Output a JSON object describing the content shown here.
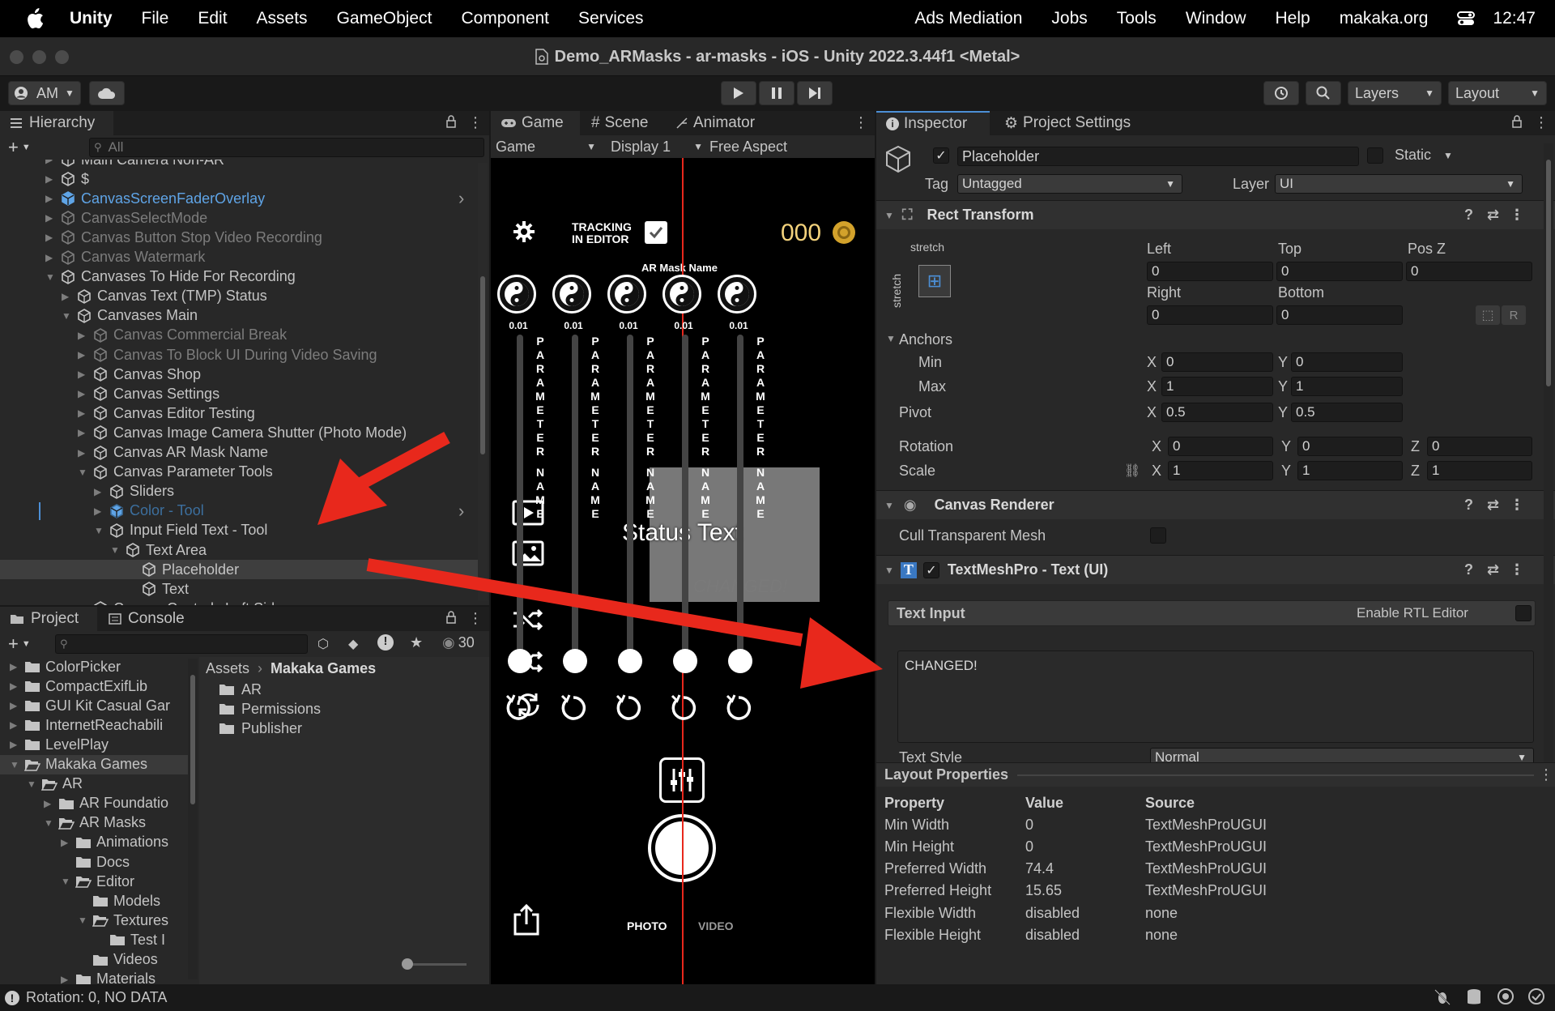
{
  "menu": {
    "unity": "Unity",
    "items": [
      "File",
      "Edit",
      "Assets",
      "GameObject",
      "Component",
      "Services"
    ],
    "right_items": [
      "Ads Mediation",
      "Jobs",
      "Tools",
      "Window",
      "Help",
      "makaka.org"
    ],
    "clock": "12:47"
  },
  "window": {
    "title": "Demo_ARMasks - ar-masks - iOS - Unity 2022.3.44f1 <Metal>"
  },
  "toolbar": {
    "account": "AM",
    "layers": "Layers",
    "layout": "Layout"
  },
  "hierarchy": {
    "tab": "Hierarchy",
    "search_placeholder": "All",
    "rows": [
      {
        "label": "Main Camera Non-AR",
        "indent": 0,
        "dim": false,
        "blue": false
      },
      {
        "label": "$",
        "indent": 0,
        "dim": false,
        "blue": false
      },
      {
        "label": "CanvasScreenFaderOverlay",
        "indent": 0,
        "dim": false,
        "blue": true
      },
      {
        "label": "CanvasSelectMode",
        "indent": 0,
        "dim": true,
        "blue": false
      },
      {
        "label": "Canvas Button Stop Video Recording",
        "indent": 0,
        "dim": true,
        "blue": false
      },
      {
        "label": "Canvas Watermark",
        "indent": 0,
        "dim": true,
        "blue": false
      },
      {
        "label": "Canvases To Hide For Recording",
        "indent": 0,
        "dim": false,
        "blue": false
      },
      {
        "label": "Canvas Text (TMP) Status",
        "indent": 1,
        "dim": false,
        "blue": false
      },
      {
        "label": "Canvases Main",
        "indent": 1,
        "dim": false,
        "blue": false
      },
      {
        "label": "Canvas Commercial Break",
        "indent": 2,
        "dim": true,
        "blue": false
      },
      {
        "label": "Canvas To Block UI During Video Saving",
        "indent": 2,
        "dim": true,
        "blue": false
      },
      {
        "label": "Canvas Shop",
        "indent": 2,
        "dim": false,
        "blue": false
      },
      {
        "label": "Canvas Settings",
        "indent": 2,
        "dim": false,
        "blue": false
      },
      {
        "label": "Canvas Editor Testing",
        "indent": 2,
        "dim": false,
        "blue": false
      },
      {
        "label": "Canvas Image Camera Shutter (Photo Mode)",
        "indent": 2,
        "dim": false,
        "blue": false
      },
      {
        "label": "Canvas AR Mask Name",
        "indent": 2,
        "dim": false,
        "blue": false
      },
      {
        "label": "Canvas Parameter Tools",
        "indent": 2,
        "dim": false,
        "blue": false
      },
      {
        "label": "Sliders",
        "indent": 3,
        "dim": false,
        "blue": false
      },
      {
        "label": "Color - Tool",
        "indent": 3,
        "dim": true,
        "blue": true
      },
      {
        "label": "Input Field Text - Tool",
        "indent": 3,
        "dim": false,
        "blue": false
      },
      {
        "label": "Text Area",
        "indent": 4,
        "dim": false,
        "blue": false
      },
      {
        "label": "Placeholder",
        "indent": 5,
        "dim": false,
        "blue": false
      },
      {
        "label": "Text",
        "indent": 5,
        "dim": false,
        "blue": false
      },
      {
        "label": "Canvas Controls Left Side",
        "indent": 2,
        "dim": false,
        "blue": false
      }
    ]
  },
  "project": {
    "tabs": [
      "Project",
      "Console"
    ],
    "count": "30",
    "tree": [
      {
        "label": "ColorPicker",
        "indent": 0
      },
      {
        "label": "CompactExifLib",
        "indent": 0
      },
      {
        "label": "GUI Kit Casual Gar",
        "indent": 0
      },
      {
        "label": "InternetReachabili",
        "indent": 0
      },
      {
        "label": "LevelPlay",
        "indent": 0
      },
      {
        "label": "Makaka Games",
        "indent": 0
      },
      {
        "label": "AR",
        "indent": 1
      },
      {
        "label": "AR Foundatio",
        "indent": 2
      },
      {
        "label": "AR Masks",
        "indent": 2
      },
      {
        "label": "Animations",
        "indent": 3
      },
      {
        "label": "Docs",
        "indent": 3
      },
      {
        "label": "Editor",
        "indent": 3
      },
      {
        "label": "Models",
        "indent": 4
      },
      {
        "label": "Textures",
        "indent": 4
      },
      {
        "label": "Test I",
        "indent": 5
      },
      {
        "label": "Videos",
        "indent": 4
      },
      {
        "label": "Materials",
        "indent": 3
      }
    ],
    "breadcrumb": [
      "Assets",
      "Makaka Games"
    ],
    "files": [
      "AR",
      "Permissions",
      "Publisher"
    ]
  },
  "game": {
    "tabs": [
      "Game",
      "Scene",
      "Animator"
    ],
    "game_dropdown": "Game",
    "display": "Display 1",
    "aspect": "Free Aspect",
    "tracking": "TRACKING\nIN EDITOR",
    "coins": "000",
    "mask_name": "AR Mask Name",
    "mask_values": [
      "0.01",
      "0.01",
      "0.01",
      "0.01",
      "0.01"
    ],
    "param_label": "PARAMETER",
    "name_label": "NAME",
    "status_text": "Status Text",
    "changed_text": "CHANGED!",
    "photo": "PHOTO",
    "video": "VIDEO"
  },
  "inspector": {
    "tabs": [
      "Inspector",
      "Project Settings"
    ],
    "object_name": "Placeholder",
    "static": "Static",
    "tag_label": "Tag",
    "tag": "Untagged",
    "layer_label": "Layer",
    "layer": "UI",
    "rect_transform": "Rect Transform",
    "stretch": "stretch",
    "left": "Left",
    "top": "Top",
    "posz": "Pos Z",
    "right": "Right",
    "bottom": "Bottom",
    "left_v": "0",
    "top_v": "0",
    "posz_v": "0",
    "right_v": "0",
    "bottom_v": "0",
    "anchors": "Anchors",
    "min": "Min",
    "max": "Max",
    "pivot": "Pivot",
    "min_x": "0",
    "min_y": "0",
    "max_x": "1",
    "max_y": "1",
    "pivot_x": "0.5",
    "pivot_y": "0.5",
    "rotation": "Rotation",
    "scale": "Scale",
    "rot_x": "0",
    "rot_y": "0",
    "rot_z": "0",
    "scale_x": "1",
    "scale_y": "1",
    "scale_z": "1",
    "canvas_renderer": "Canvas Renderer",
    "cull": "Cull Transparent Mesh",
    "tmp": "TextMeshPro - Text (UI)",
    "text_input": "Text Input",
    "rtl": "Enable RTL Editor",
    "text_value": "CHANGED!",
    "text_style_label": "Text Style",
    "text_style": "Normal",
    "r_button": "R"
  },
  "layout_props": {
    "title": "Layout Properties",
    "headers": [
      "Property",
      "Value",
      "Source"
    ],
    "rows": [
      [
        "Min Width",
        "0",
        "TextMeshProUGUI"
      ],
      [
        "Min Height",
        "0",
        "TextMeshProUGUI"
      ],
      [
        "Preferred Width",
        "74.4",
        "TextMeshProUGUI"
      ],
      [
        "Preferred Height",
        "15.65",
        "TextMeshProUGUI"
      ],
      [
        "Flexible Width",
        "disabled",
        "none"
      ],
      [
        "Flexible Height",
        "disabled",
        "none"
      ]
    ]
  },
  "status_bar": {
    "text": "Rotation: 0, NO DATA"
  },
  "colors": {
    "accent_blue": "#4c8fd6",
    "arrow_red": "#e8281c",
    "bg": "#282828"
  }
}
